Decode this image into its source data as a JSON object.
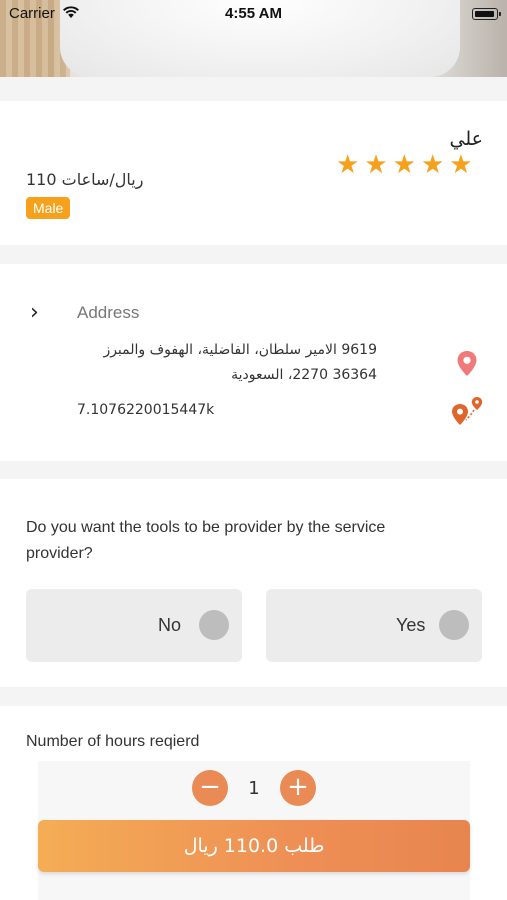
{
  "status_bar": {
    "carrier": "Carrier",
    "time": "4:55 AM"
  },
  "provider": {
    "name": "علي",
    "rating": 5,
    "stars": [
      "★",
      "★",
      "★",
      "★",
      "★"
    ],
    "price": "110 ريال/ساعات",
    "gender_badge": "Male"
  },
  "address": {
    "title": "Address",
    "line1": "9619 الامير سلطان، الفاضلية، الهفوف والمبرز",
    "line2": "36364 2270، السعودية",
    "distance": "7.1076220015447k"
  },
  "tools": {
    "question": "Do you want the tools to be provider by the service provider?",
    "option_no": "No",
    "option_yes": "Yes"
  },
  "hours": {
    "label": "Number of hours reqierd",
    "minus": "−",
    "plus": "+",
    "value": "1"
  },
  "order_button": "طلب 110.0 ريال",
  "colors": {
    "accent": "#f5a11c",
    "button_start": "#f4ad55",
    "button_end": "#e8854f",
    "stepper": "#ea8a55",
    "pin": "#f07a7a",
    "route_pin": "#e0652a"
  },
  "icons": {
    "chevron": "chevron-right-icon",
    "location": "location-pin-icon",
    "route": "route-pin-icon"
  }
}
